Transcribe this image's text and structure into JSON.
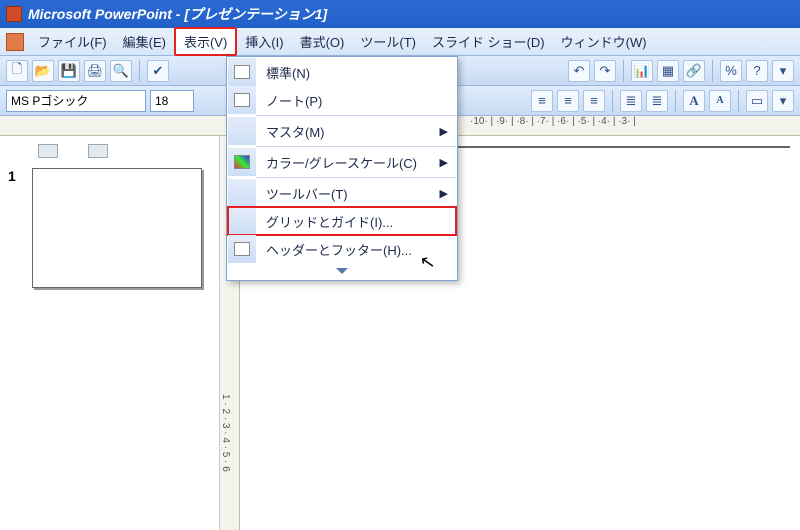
{
  "title": "Microsoft PowerPoint - [プレゼンテーション1]",
  "menus": {
    "file": "ファイル(F)",
    "edit": "編集(E)",
    "view": "表示(V)",
    "insert": "挿入(I)",
    "format": "書式(O)",
    "tools": "ツール(T)",
    "slideshow": "スライド ショー(D)",
    "window": "ウィンドウ(W)"
  },
  "font": {
    "name": "MS Pゴシック",
    "size": "18"
  },
  "ruler_h": "·10· | ·9· | ·8· | ·7· | ·6· | ·5· | ·4· | ·3· |",
  "ruler_v": "1 · 2 · 3 · 4 · 5 · 6",
  "outline": {
    "slide_number": "1"
  },
  "view_menu": {
    "normal": "標準(N)",
    "notes": "ノート(P)",
    "master": "マスタ(M)",
    "color": "カラー/グレースケール(C)",
    "toolbars": "ツールバー(T)",
    "grid": "グリッドとガイド(I)...",
    "headerfoot": "ヘッダーとフッター(H)..."
  }
}
